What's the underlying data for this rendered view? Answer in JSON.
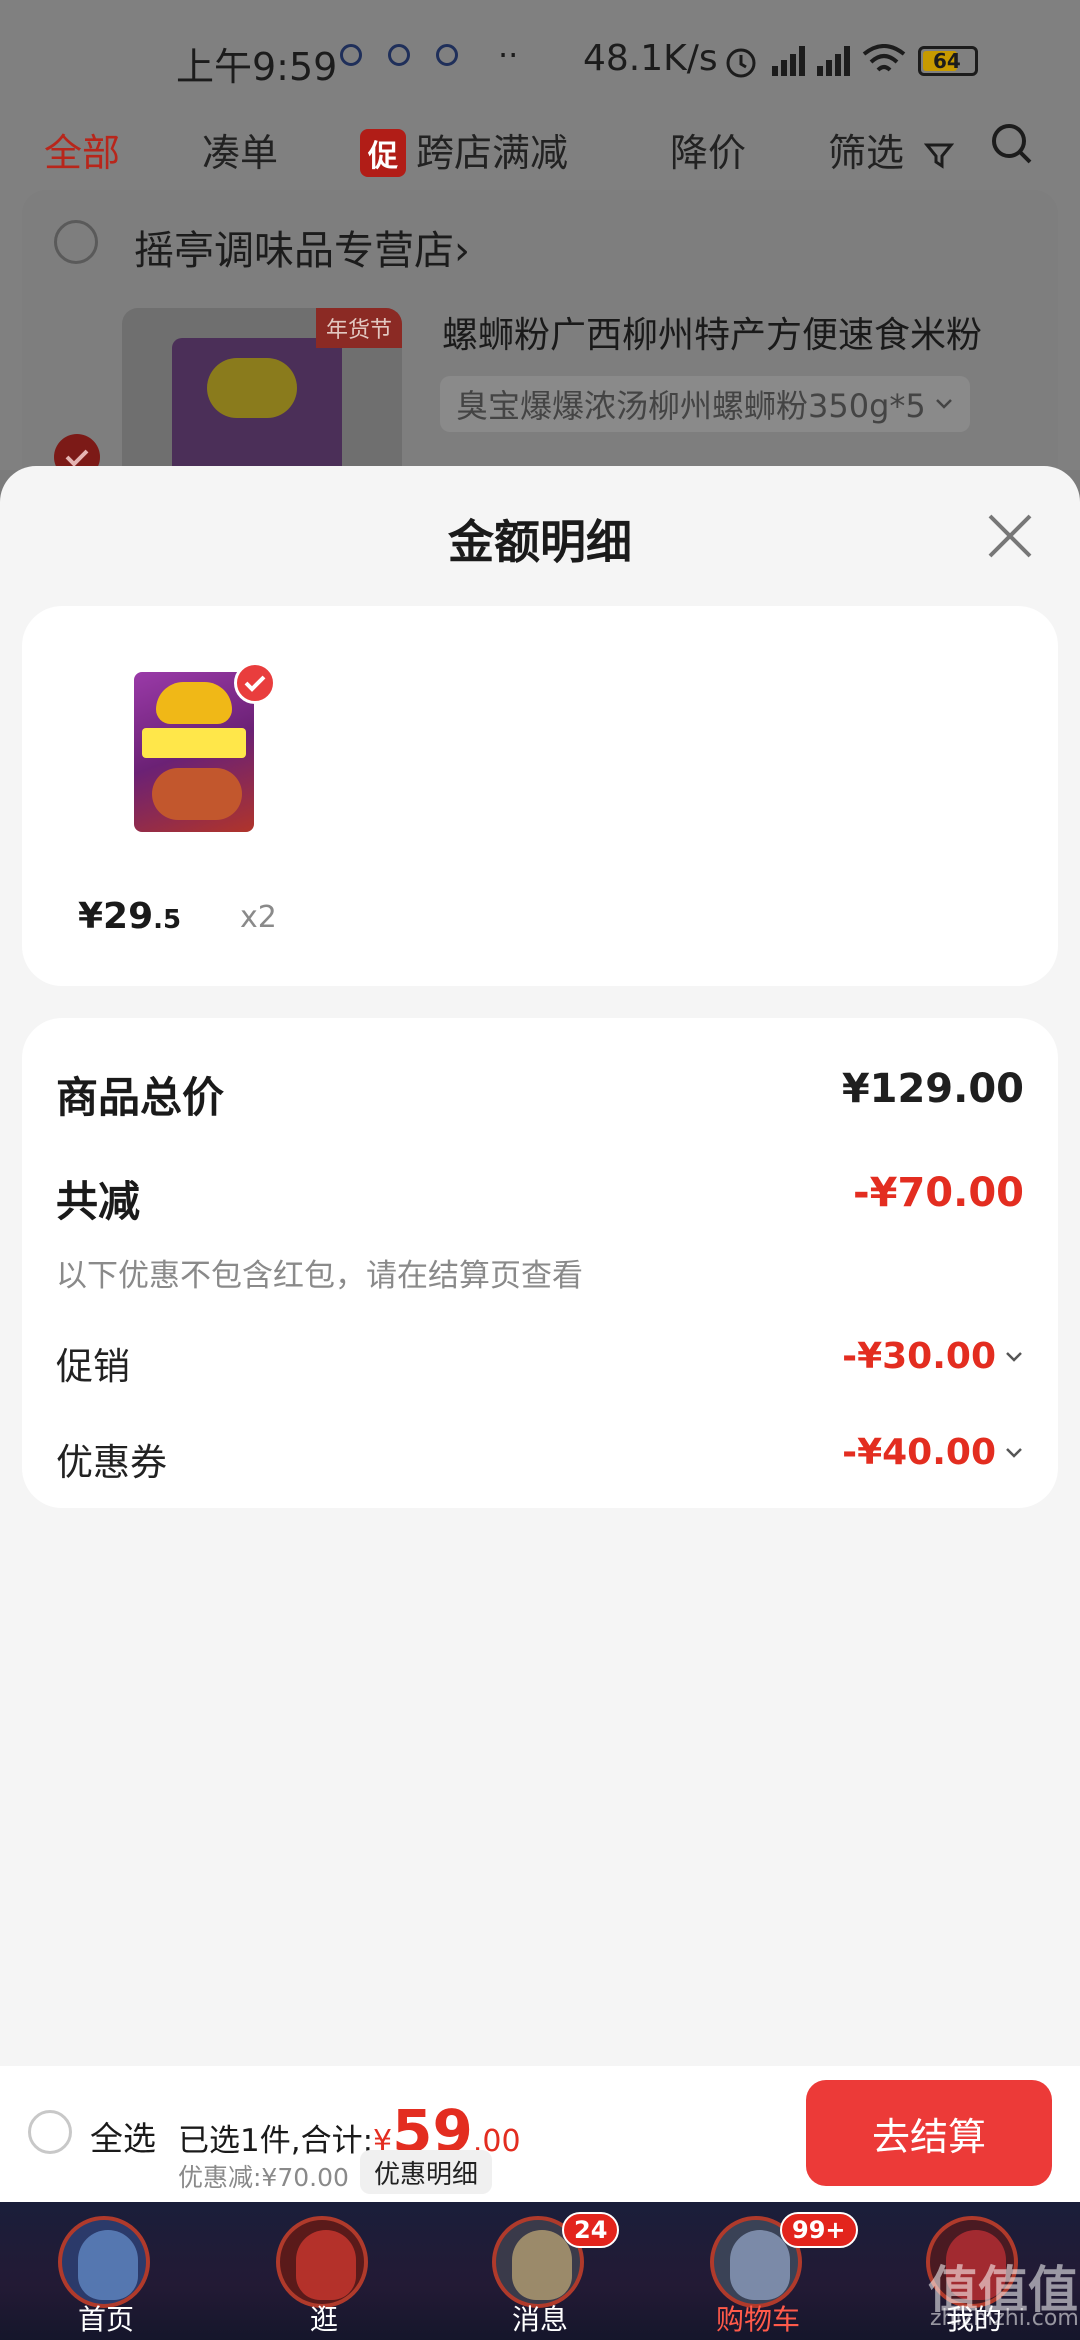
{
  "status_bar": {
    "time": "上午9:59",
    "more": "··",
    "net_speed": "48.1K/s",
    "battery": "64"
  },
  "filter_bar": {
    "tabs": [
      "全部",
      "凑单",
      "跨店满减",
      "降价",
      "筛选"
    ],
    "promo_badge": "促"
  },
  "store": {
    "name": "摇亭调味品专营店",
    "chevron": "›",
    "product_title": "螺蛳粉广西柳州特产方便速食米粉",
    "sku": "臭宝爆爆浓汤柳州螺蛳粉350g*5",
    "new_year_tag": "年货节"
  },
  "sheet": {
    "title": "金额明细",
    "item": {
      "price_int": "¥29",
      "price_dec": ".5",
      "qty": "x2"
    },
    "summary": {
      "total_label": "商品总价",
      "total_value": "¥129.00",
      "reduce_label": "共减",
      "reduce_value": "-¥70.00",
      "note": "以下优惠不包含红包，请在结算页查看",
      "promo_label": "促销",
      "promo_value": "-¥30.00",
      "coupon_label": "优惠券",
      "coupon_value": "-¥40.00"
    }
  },
  "checkout": {
    "select_all": "全选",
    "selected_text": "已选1件,合计:",
    "currency": "¥",
    "total_int": "59",
    "total_dec": ".00",
    "discount": "优惠减:¥70.00",
    "detail_chip": "优惠明细",
    "button": "去结算"
  },
  "tabbar": {
    "items": [
      {
        "label": "首页"
      },
      {
        "label": "逛"
      },
      {
        "label": "消息",
        "badge": "24"
      },
      {
        "label": "购物车",
        "badge": "99+"
      },
      {
        "label": "我的"
      }
    ]
  },
  "watermark": {
    "main": "值值值",
    "sub": "zhizhizhi.com"
  },
  "colors": {
    "accent_red": "#e32d20",
    "button_red": "#ec3a38",
    "sheet_bg": "#f5f5f5"
  }
}
